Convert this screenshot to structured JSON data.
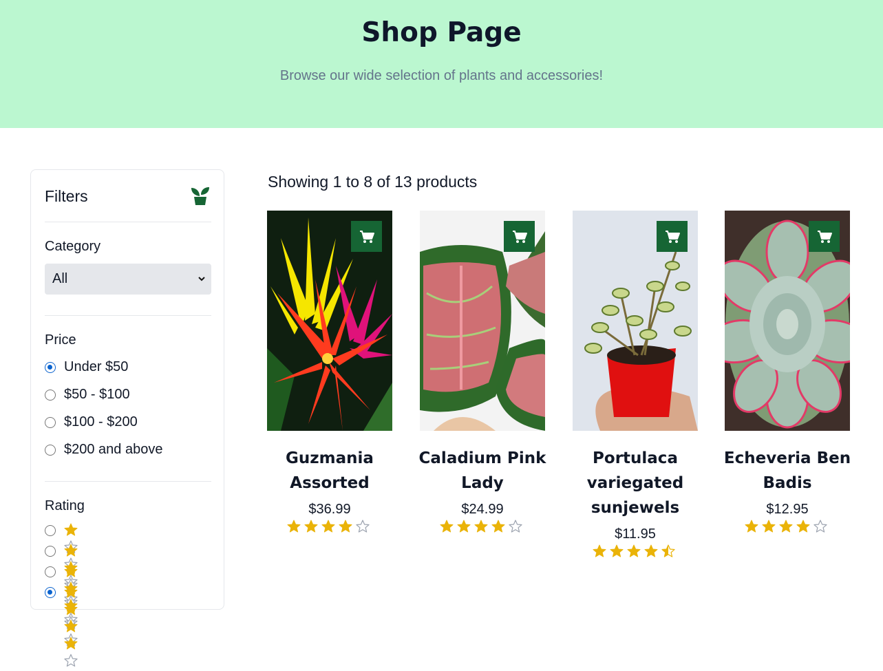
{
  "header": {
    "title": "Shop Page",
    "subtitle": "Browse our wide selection of plants and accessories!"
  },
  "filters": {
    "title": "Filters",
    "icon": "plant-icon",
    "category": {
      "label": "Category",
      "selected": "All"
    },
    "price": {
      "label": "Price",
      "options": [
        {
          "label": "Under $50",
          "checked": true
        },
        {
          "label": "$50 - $100",
          "checked": false
        },
        {
          "label": "$100 - $200",
          "checked": false
        },
        {
          "label": "$200 and above",
          "checked": false
        }
      ]
    },
    "rating": {
      "label": "Rating",
      "options": [
        {
          "stars": 1,
          "checked": false
        },
        {
          "stars": 2,
          "checked": false
        },
        {
          "stars": 3,
          "checked": false
        },
        {
          "stars": 4,
          "checked": true
        }
      ]
    }
  },
  "results": {
    "summary": "Showing 1 to 8 of 13 products"
  },
  "colors": {
    "header_bg": "#bbf7d0",
    "accent_green": "#166534",
    "star": "#eab308",
    "radio": "#0b63ce"
  },
  "products": [
    {
      "name": "Guzmania Assorted",
      "price": "$36.99",
      "rating": 4,
      "image": "guzmania-photo"
    },
    {
      "name": "Caladium Pink Lady",
      "price": "$24.99",
      "rating": 4,
      "image": "caladium-photo"
    },
    {
      "name": "Portulaca variegated sunjewels",
      "price": "$11.95",
      "rating": 4.5,
      "image": "portulaca-photo"
    },
    {
      "name": "Echeveria Ben Badis",
      "price": "$12.95",
      "rating": 4,
      "image": "echeveria-photo"
    }
  ]
}
